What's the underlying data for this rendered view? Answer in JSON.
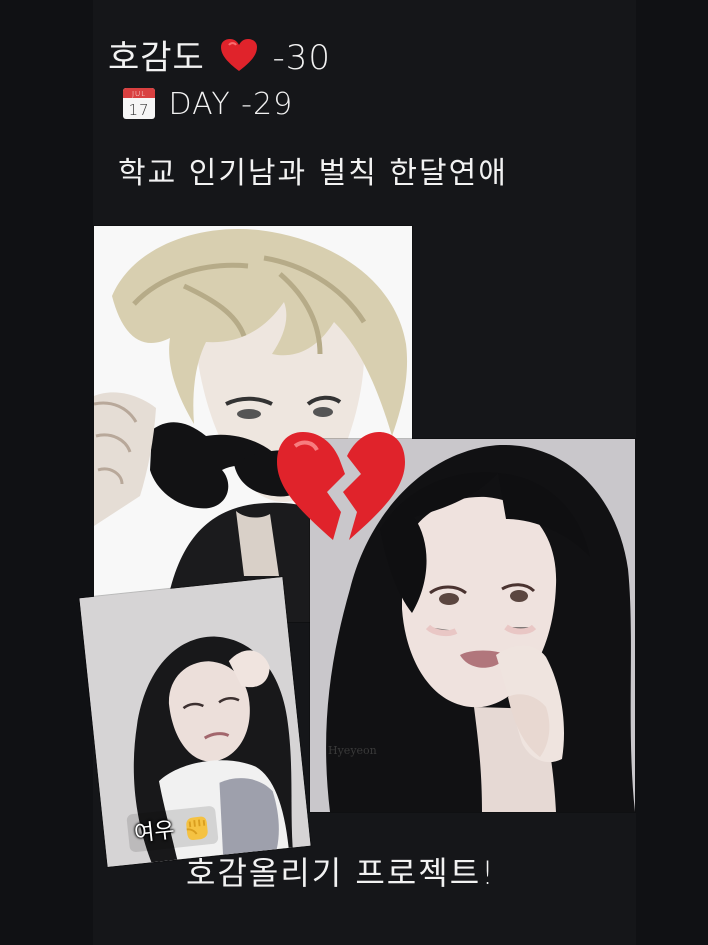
{
  "header": {
    "affinity_prefix": "호감도",
    "affinity_value": "-30",
    "affinity_icon": "red-heart-icon",
    "day_calendar_month": "JUL",
    "day_calendar_date": "17",
    "day_text": "DAY -29",
    "day_icon": "calendar-icon",
    "title": "학교 인기남과 벌칙 한달연애"
  },
  "images": {
    "man": {
      "signature": ""
    },
    "woman": {
      "signature": "Hyeyeon"
    },
    "small": {
      "caption": "여우",
      "caption_icon": "fist-icon"
    }
  },
  "center_icon": "broken-heart-icon",
  "footer": {
    "project_text": "호감올리기 프로젝트!"
  },
  "colors": {
    "background": "#151619",
    "text": "#f2f2f2",
    "heart": "#e0232b"
  }
}
